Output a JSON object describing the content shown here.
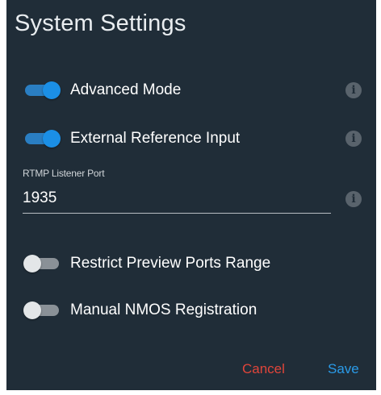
{
  "dialog": {
    "title": "System Settings",
    "toggles": [
      {
        "label": "Advanced Mode",
        "on": true
      },
      {
        "label": "External Reference Input",
        "on": true
      },
      {
        "label": "Restrict Preview Ports Range",
        "on": false
      },
      {
        "label": "Manual NMOS Registration",
        "on": false
      }
    ],
    "rtmp_port": {
      "label": "RTMP Listener Port",
      "value": "1935"
    },
    "info_glyph": "i",
    "cancel_label": "Cancel",
    "save_label": "Save"
  },
  "colors": {
    "background": "#202d38",
    "toggle_on": "#1b8fe6",
    "toggle_off": "#e3e6e8",
    "cancel": "#e0453a",
    "save": "#2a9be8"
  }
}
